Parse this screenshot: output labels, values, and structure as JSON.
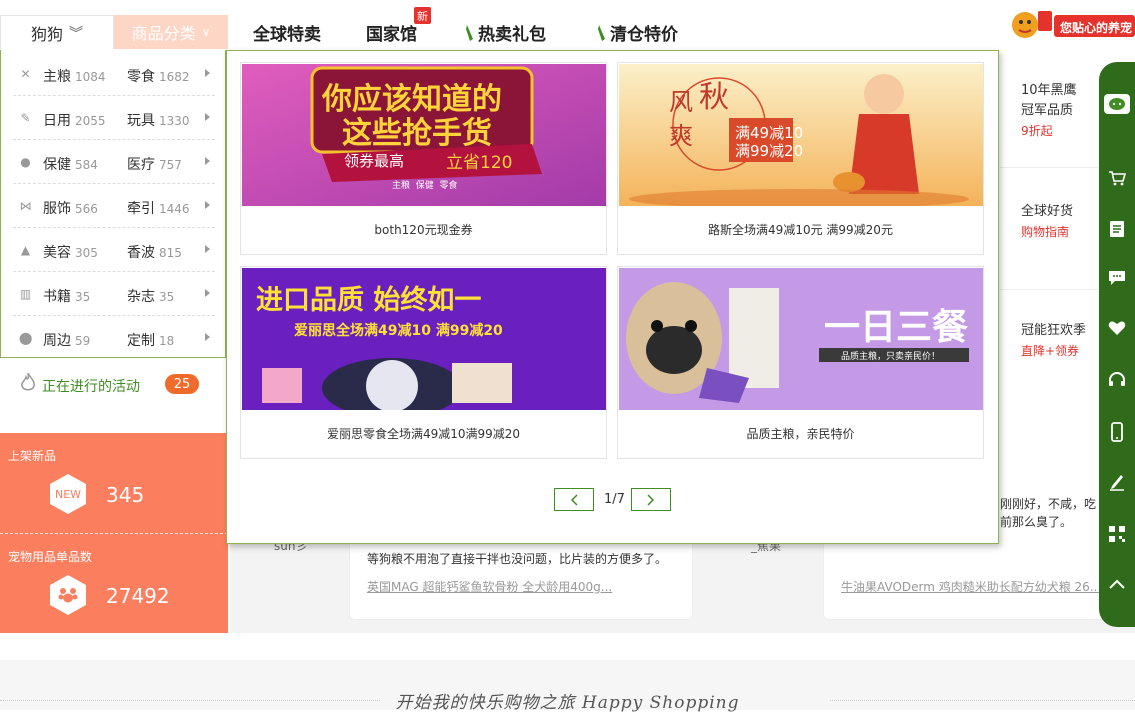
{
  "header": {
    "pet_selector": "狗狗",
    "category_tab": "商品分类",
    "nav": [
      "全球特卖",
      "国家馆",
      "热卖礼包",
      "清仓特价"
    ],
    "new_badge": "新",
    "promo_text": "您贴心的养宠"
  },
  "categories": [
    {
      "a": "主粮",
      "a_count": "1084",
      "b": "零食",
      "b_count": "1682",
      "icon": "bone-icon"
    },
    {
      "a": "日用",
      "a_count": "2055",
      "b": "玩具",
      "b_count": "1330",
      "icon": "tool-icon"
    },
    {
      "a": "保健",
      "a_count": "584",
      "b": "医疗",
      "b_count": "757",
      "icon": "health-icon"
    },
    {
      "a": "服饰",
      "a_count": "566",
      "b": "牵引",
      "b_count": "1446",
      "icon": "bowtie-icon"
    },
    {
      "a": "美容",
      "a_count": "305",
      "b": "香波",
      "b_count": "815",
      "icon": "grooming-icon"
    },
    {
      "a": "书籍",
      "a_count": "35",
      "b": "杂志",
      "b_count": "35",
      "icon": "book-icon"
    },
    {
      "a": "周边",
      "a_count": "59",
      "b": "定制",
      "b_count": "18",
      "icon": "location-icon"
    }
  ],
  "activities": {
    "label": "正在进行的活动",
    "count": "25"
  },
  "stats": [
    {
      "label": "上架新品",
      "badge": "NEW",
      "value": "345"
    },
    {
      "label": "宠物用品单品数",
      "badge": "",
      "value": "27492"
    }
  ],
  "right_column": [
    {
      "title": "10年黑鹰",
      "title2": "冠军品质",
      "sub": "9折起"
    },
    {
      "title": "全球好货",
      "sub": "购物指南"
    },
    {
      "title": "冠能狂欢季",
      "sub": "直降+领券"
    }
  ],
  "dropdown": {
    "cards": [
      {
        "caption": "both120元现金券",
        "banner_line1": "你应该知道的",
        "banner_line2": "这些抢手货",
        "banner_tag1": "领券最高",
        "banner_tag2": "立省120",
        "banner_small": "主粮  保健  零食"
      },
      {
        "caption": "路斯全场满49减10元 满99减20元",
        "banner_line1": "秋",
        "banner_line2": "风",
        "banner_line3": "爽",
        "banner_deal1": "满49减10",
        "banner_deal2": "满99减20"
      },
      {
        "caption": "爱丽思零食全场满49减10满99减20",
        "banner_line1": "进口品质 始终如一",
        "banner_line2": "爱丽思全场满49减10 满99减20"
      },
      {
        "caption": "品质主粮，亲民特价",
        "banner_line1": "一日三餐",
        "banner_line2": "品质主粮，只卖亲民价！"
      }
    ],
    "pager": "1/7"
  },
  "reviews": [
    {
      "author": "sun彡",
      "text": "等狗粮不用泡了直接干拌也没问题，比片装的方便多了。",
      "link": "英国MAG 超能钙鲨鱼软骨粉 全犬龄用400g..."
    },
    {
      "author": "_蕉果",
      "text_top": "刚刚好，不咸，吃",
      "text": "前那么臭了。",
      "link": "牛油果AVODerm 鸡肉糙米助长配方幼犬粮 26..."
    }
  ],
  "footer": {
    "title": "开始我的快乐购物之旅 Happy Shopping"
  },
  "colors": {
    "brand_green": "#3f8d23",
    "accent_orange": "#fb7e5e",
    "sidebar_green": "#2f6b1b",
    "badge_red": "#e5322d"
  }
}
